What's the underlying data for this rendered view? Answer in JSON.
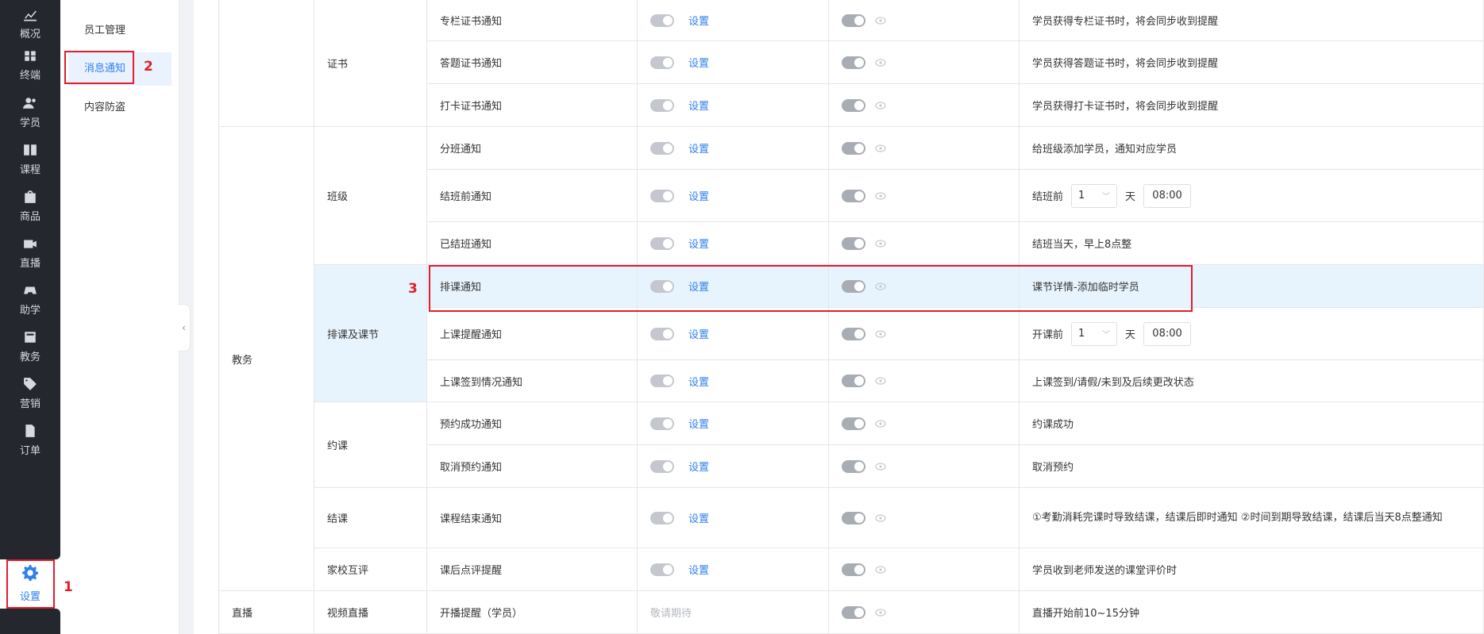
{
  "nav": {
    "items": [
      {
        "label": "概况",
        "icon": "chart-icon"
      },
      {
        "label": "终端",
        "icon": "terminal-icon"
      },
      {
        "label": "学员",
        "icon": "students-icon"
      },
      {
        "label": "课程",
        "icon": "book-icon"
      },
      {
        "label": "商品",
        "icon": "bag-icon"
      },
      {
        "label": "直播",
        "icon": "camera-icon"
      },
      {
        "label": "助学",
        "icon": "gamepad-icon"
      },
      {
        "label": "教务",
        "icon": "calendar-icon"
      },
      {
        "label": "营销",
        "icon": "tag-icon"
      },
      {
        "label": "订单",
        "icon": "document-icon"
      }
    ],
    "active": {
      "label": "设置",
      "icon": "gear-icon"
    }
  },
  "submenu": {
    "items": [
      "员工管理",
      "消息通知",
      "内容防盗"
    ],
    "active_index": 1
  },
  "annotations": {
    "one": "1",
    "two": "2",
    "three": "3"
  },
  "table": {
    "set_label": "设置",
    "groups": {
      "jiaowu": "教务",
      "zhibo": "直播"
    },
    "subgroups": {
      "zhengshu": "证书",
      "banji": "班级",
      "paike": "排课及课节",
      "yueke": "约课",
      "jieke": "结课",
      "jiaxiao": "家校互评",
      "shipin": "视频直播"
    },
    "rows": [
      {
        "name": "专栏证书通知",
        "desc": "学员获得专栏证书时，将会同步收到提醒"
      },
      {
        "name": "答题证书通知",
        "desc": "学员获得答题证书时，将会同步收到提醒"
      },
      {
        "name": "打卡证书通知",
        "desc": "学员获得打卡证书时，将会同步收到提醒"
      },
      {
        "name": "分班通知",
        "desc": "给班级添加学员，通知对应学员"
      },
      {
        "name": "结班前通知",
        "desc_prefix": "结班前",
        "select": "1",
        "unit": "天",
        "time": "08:00"
      },
      {
        "name": "已结班通知",
        "desc": "结班当天，早上8点整"
      },
      {
        "name": "排课通知",
        "desc": "课节详情-添加临时学员"
      },
      {
        "name": "上课提醒通知",
        "desc_prefix": "开课前",
        "select": "1",
        "unit": "天",
        "time": "08:00"
      },
      {
        "name": "上课签到情况通知",
        "desc": "上课签到/请假/未到及后续更改状态"
      },
      {
        "name": "预约成功通知",
        "desc": "约课成功"
      },
      {
        "name": "取消预约通知",
        "desc": "取消预约"
      },
      {
        "name": "课程结束通知",
        "desc": "①考勤消耗完课时导致结课，结课后即时通知 ②时间到期导致结课，结课后当天8点整通知"
      },
      {
        "name": "课后点评提醒",
        "desc": "学员收到老师发送的课堂评价时"
      },
      {
        "name": "开播提醒（学员）",
        "pending": "敬请期待",
        "desc": "直播开始前10~15分钟"
      }
    ]
  },
  "colors": {
    "accent": "#2f80ed",
    "annotation": "#e21d2c",
    "nav_bg": "#24272d",
    "highlight": "#e8f4fd"
  }
}
